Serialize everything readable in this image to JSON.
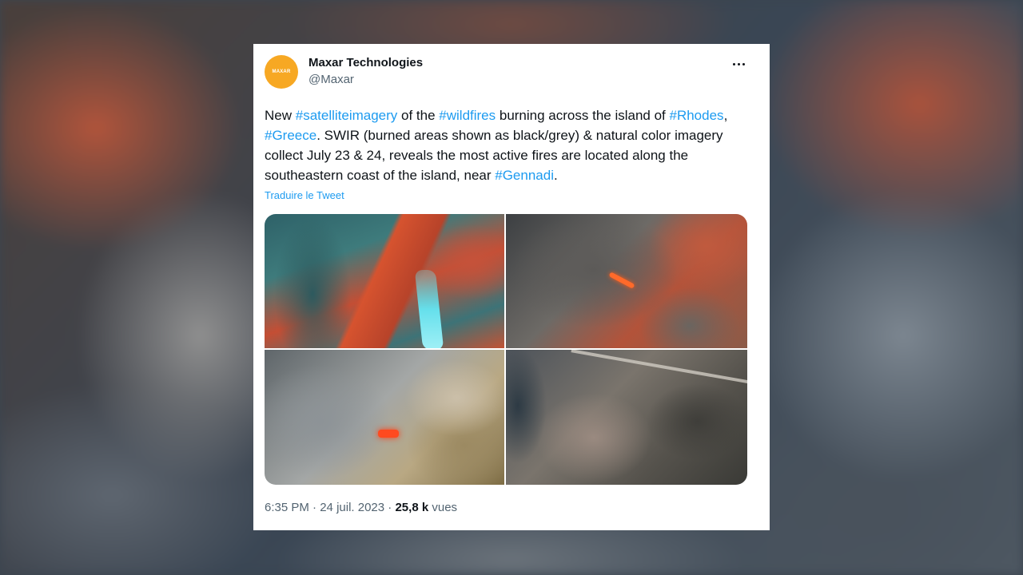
{
  "tweet": {
    "avatar_text": "MAXAR",
    "display_name": "Maxar Technologies",
    "handle": "@Maxar",
    "body": [
      {
        "type": "text",
        "value": "New "
      },
      {
        "type": "tag",
        "value": "#satelliteimagery"
      },
      {
        "type": "text",
        "value": " of the "
      },
      {
        "type": "tag",
        "value": "#wildfires"
      },
      {
        "type": "text",
        "value": " burning across the island of "
      },
      {
        "type": "tag",
        "value": "#Rhodes"
      },
      {
        "type": "text",
        "value": ", "
      },
      {
        "type": "tag",
        "value": "#Greece"
      },
      {
        "type": "text",
        "value": ". SWIR (burned areas shown as black/grey) & natural color imagery collect July 23 & 24, reveals the most active fires are located along the southeastern coast of the island, near "
      },
      {
        "type": "tag",
        "value": "#Gennadi"
      },
      {
        "type": "text",
        "value": "."
      }
    ],
    "translate_label": "Traduire le Tweet",
    "time": "6:35 PM",
    "separator": "·",
    "date": "24 juil. 2023",
    "views_count": "25,8 k",
    "views_label": "vues"
  },
  "colors": {
    "link": "#1d9bf0",
    "avatar_bg": "#f7a823",
    "text_primary": "#0f1419",
    "text_secondary": "#536471"
  },
  "icons": {
    "more": "more-horizontal-icon"
  }
}
